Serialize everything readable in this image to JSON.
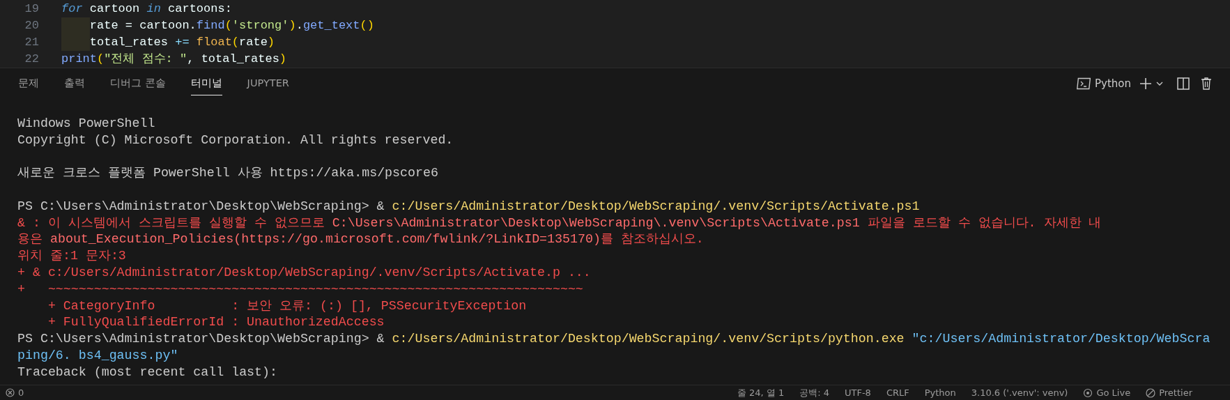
{
  "editor": {
    "lines": [
      {
        "number": "19",
        "segments": [
          {
            "kind": "keyword",
            "text": "for"
          },
          {
            "kind": "plain",
            "text": " cartoon "
          },
          {
            "kind": "keyword",
            "text": "in"
          },
          {
            "kind": "plain",
            "text": " cartoons:"
          }
        ]
      },
      {
        "number": "20",
        "indented": true,
        "segments": [
          {
            "kind": "plain",
            "text": "rate = cartoon."
          },
          {
            "kind": "func",
            "text": "find"
          },
          {
            "kind": "paren",
            "text": "("
          },
          {
            "kind": "string",
            "text": "'strong'"
          },
          {
            "kind": "paren",
            "text": ")"
          },
          {
            "kind": "plain",
            "text": "."
          },
          {
            "kind": "func",
            "text": "get_text"
          },
          {
            "kind": "paren",
            "text": "()"
          }
        ]
      },
      {
        "number": "21",
        "indented": true,
        "segments": [
          {
            "kind": "plain",
            "text": "total_rates "
          },
          {
            "kind": "operator",
            "text": "+="
          },
          {
            "kind": "builtin",
            "text": " float"
          },
          {
            "kind": "paren",
            "text": "("
          },
          {
            "kind": "plain",
            "text": "rate"
          },
          {
            "kind": "paren",
            "text": ")"
          }
        ]
      },
      {
        "number": "22",
        "segments": [
          {
            "kind": "func",
            "text": "print"
          },
          {
            "kind": "paren",
            "text": "("
          },
          {
            "kind": "string",
            "text": "\"전체 점수: \""
          },
          {
            "kind": "plain",
            "text": ", total_rates"
          },
          {
            "kind": "paren",
            "text": ")"
          }
        ]
      }
    ]
  },
  "panel": {
    "tabs": [
      {
        "label": "문제",
        "selected": false
      },
      {
        "label": "출력",
        "selected": false
      },
      {
        "label": "디버그 콘솔",
        "selected": false
      },
      {
        "label": "터미널",
        "selected": true
      },
      {
        "label": "JUPYTER",
        "selected": false
      }
    ],
    "terminal_name": "Python"
  },
  "terminal": {
    "blocks": [
      {
        "lines": [
          {
            "segments": [
              {
                "kind": "plain",
                "text": "Windows PowerShell"
              }
            ]
          },
          {
            "segments": [
              {
                "kind": "plain",
                "text": "Copyright (C) Microsoft Corporation. All rights reserved."
              }
            ]
          }
        ]
      },
      {
        "lines": [
          {
            "segments": [
              {
                "kind": "plain",
                "text": "새로운 크로스 플랫폼 PowerShell 사용 https://aka.ms/pscore6"
              }
            ]
          }
        ]
      },
      {
        "lines": [
          {
            "segments": [
              {
                "kind": "plain",
                "text": "PS C:\\Users\\Administrator\\Desktop\\WebScraping> & "
              },
              {
                "kind": "path",
                "text": "c:/Users/Administrator/Desktop/WebScraping/.venv/Scripts/Activate.ps1"
              }
            ]
          },
          {
            "segments": [
              {
                "kind": "error",
                "text": "& : 이 시스템에서 스크립트를 실행할 수 없으므로 "
              },
              {
                "kind": "error-strong",
                "text": "C:\\Users\\Administrator\\Desktop\\WebScraping\\.venv\\Scripts\\Activate.ps1"
              },
              {
                "kind": "error",
                "text": " 파일을 로드할 수 없습니다. 자세한 내"
              }
            ]
          },
          {
            "segments": [
              {
                "kind": "error",
                "text": "용은 "
              },
              {
                "kind": "error-strong",
                "text": "about_Execution_Policies(https://go.microsoft.com/fwlink/?LinkID=135170)"
              },
              {
                "kind": "error",
                "text": "를 참조하십시오."
              }
            ]
          },
          {
            "segments": [
              {
                "kind": "error",
                "text": "위치 줄:1 문자:3"
              }
            ]
          },
          {
            "segments": [
              {
                "kind": "error",
                "text": "+ & c:/Users/Administrator/Desktop/WebScraping/.venv/Scripts/Activate.p ..."
              }
            ]
          },
          {
            "segments": [
              {
                "kind": "error",
                "text": "+   ~~~~~~~~~~~~~~~~~~~~~~~~~~~~~~~~~~~~~~~~~~~~~~~~~~~~~~~~~~~~~~~~~~~~~~"
              }
            ]
          },
          {
            "segments": [
              {
                "kind": "error",
                "text": "    + CategoryInfo          : 보안 오류: (:) [], PSSecurityException"
              }
            ]
          },
          {
            "segments": [
              {
                "kind": "error",
                "text": "    + FullyQualifiedErrorId : UnauthorizedAccess"
              }
            ]
          },
          {
            "segments": [
              {
                "kind": "plain",
                "text": "PS C:\\Users\\Administrator\\Desktop\\WebScraping> & "
              },
              {
                "kind": "path",
                "text": "c:/Users/Administrator/Desktop/WebScraping/.venv/Scripts/python.exe"
              },
              {
                "kind": "string",
                "text": " \"c:/Users/Administrator/Desktop/WebScra"
              }
            ]
          },
          {
            "segments": [
              {
                "kind": "string",
                "text": "ping/6. bs4_gauss.py\""
              }
            ]
          },
          {
            "segments": [
              {
                "kind": "plain",
                "text": "Traceback (most recent call last):"
              }
            ]
          }
        ]
      }
    ]
  },
  "status_bar": {
    "left": [
      {
        "kind": "errors",
        "text": "0"
      }
    ],
    "right": [
      {
        "kind": "text",
        "text": "줄 24, 열 1"
      },
      {
        "kind": "text",
        "text": "공백: 4"
      },
      {
        "kind": "text",
        "text": "UTF-8"
      },
      {
        "kind": "text",
        "text": "CRLF"
      },
      {
        "kind": "text",
        "text": "Python"
      },
      {
        "kind": "text",
        "text": "3.10.6 ('.venv': venv)"
      },
      {
        "kind": "golive",
        "text": "Go Live"
      },
      {
        "kind": "prettier",
        "text": "Prettier"
      }
    ]
  }
}
